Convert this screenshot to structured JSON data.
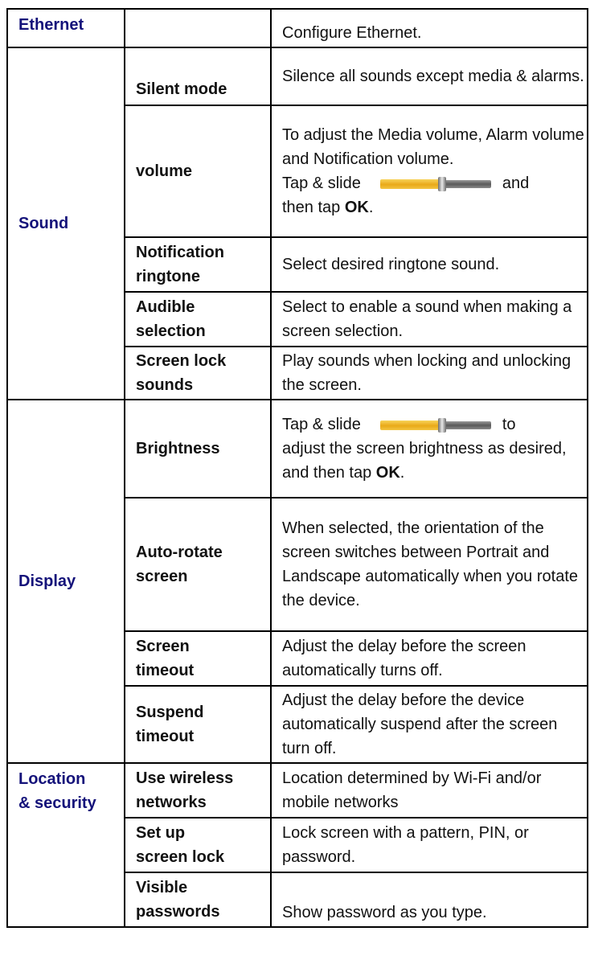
{
  "colors": {
    "category": "#14127a",
    "slider_fill": "#e9a918",
    "slider_track": "#6e6e6e"
  },
  "slider_level": 0.56,
  "sections": {
    "ethernet": {
      "category": "Ethernet",
      "desc": "Configure Ethernet."
    },
    "sound": {
      "category": "Sound",
      "silent_mode": {
        "label": "Silent mode",
        "desc": "Silence all sounds except media & alarms."
      },
      "volume": {
        "label": "volume",
        "desc_intro": "To adjust the Media volume, Alarm volume and Notification volume.",
        "tap": "Tap & slide",
        "and": "and",
        "then_tap": "then tap",
        "ok": "OK",
        "period": "."
      },
      "notification": {
        "label_1": "Notification",
        "label_2": "ringtone",
        "desc": "Select desired ringtone sound."
      },
      "audible": {
        "label_1": "Audible",
        "label_2": "selection",
        "desc": "Select to enable a sound when making a screen selection."
      },
      "lock_sounds": {
        "label_1": "Screen lock",
        "label_2": "sounds",
        "desc": "Play sounds when locking and unlocking the screen."
      }
    },
    "display": {
      "category": "Display",
      "brightness": {
        "label": "Brightness",
        "tap": "Tap & slide",
        "to": "to",
        "desc_rest": "adjust the screen brightness as desired, and then tap",
        "ok": "OK",
        "period": "."
      },
      "auto_rotate": {
        "label_1": "Auto-rotate",
        "label_2": "screen",
        "desc": "When selected, the orientation of the screen switches between Portrait and Landscape automatically when you rotate the device."
      },
      "screen_timeout": {
        "label_1": "Screen",
        "label_2": "timeout",
        "desc": "Adjust the delay before the screen automatically turns off."
      },
      "suspend_timeout": {
        "label_1": "Suspend",
        "label_2": "timeout",
        "desc": "Adjust the delay before the device automatically suspend after the screen turn off."
      }
    },
    "location": {
      "category_1": "Location",
      "category_2": "& security",
      "wireless": {
        "label_1": "Use wireless",
        "label_2": "networks",
        "desc": "Location determined by Wi-Fi and/or mobile networks"
      },
      "screen_lock": {
        "label_1": "Set up",
        "label_2": "screen lock",
        "desc": "Lock screen with a pattern, PIN, or password."
      },
      "visible_pw": {
        "label_1": "Visible",
        "label_2": "passwords",
        "desc": "Show password as you type."
      }
    }
  }
}
